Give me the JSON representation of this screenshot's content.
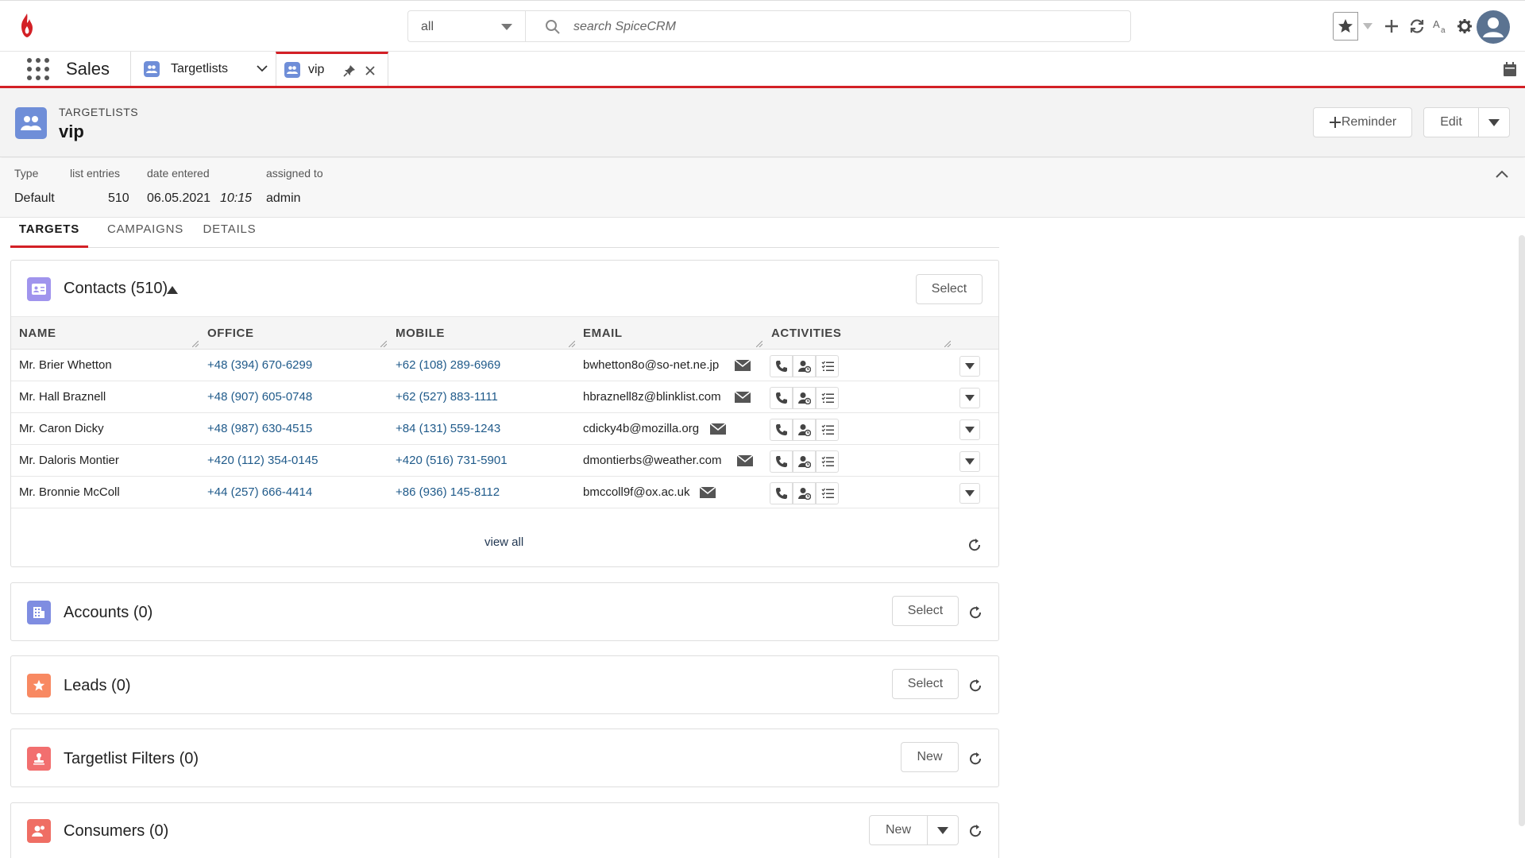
{
  "header": {
    "scope_value": "all",
    "search_placeholder": "search SpiceCRM"
  },
  "nav": {
    "app_name": "Sales",
    "tabs": [
      {
        "label": "Targetlists"
      },
      {
        "label": "vip"
      }
    ]
  },
  "record": {
    "module": "TARGETLISTS",
    "title": "vip",
    "reminder_label": "Reminder",
    "edit_label": "Edit"
  },
  "fields": {
    "labels": {
      "type": "Type",
      "entries": "list entries",
      "date": "date entered",
      "assigned": "assigned to"
    },
    "values": {
      "type": "Default",
      "entries": "510",
      "date": "06.05.2021",
      "time": "10:15",
      "assigned": "admin"
    }
  },
  "tabs": [
    "TARGETS",
    "CAMPAIGNS",
    "DETAILS"
  ],
  "contacts": {
    "title": "Contacts (510)",
    "select_label": "Select",
    "columns": [
      "NAME",
      "OFFICE",
      "MOBILE",
      "EMAIL",
      "ACTIVITIES"
    ],
    "rows": [
      {
        "name": "Mr. Brier Whetton",
        "office": "+48 (394) 670-6299",
        "mobile": "+62 (108) 289-6969",
        "email": "bwhetton8o@so-net.ne.jp"
      },
      {
        "name": "Mr. Hall Braznell",
        "office": "+48 (907) 605-0748",
        "mobile": "+62 (527) 883-1111",
        "email": "hbraznell8z@blinklist.com"
      },
      {
        "name": "Mr. Caron Dicky",
        "office": "+48 (987) 630-4515",
        "mobile": "+84 (131) 559-1243",
        "email": "cdicky4b@mozilla.org"
      },
      {
        "name": "Mr. Daloris Montier",
        "office": "+420 (112) 354-0145",
        "mobile": "+420 (516) 731-5901",
        "email": "dmontierbs@weather.com"
      },
      {
        "name": "Mr. Bronnie McColl",
        "office": "+44 (257) 666-4414",
        "mobile": "+86 (936) 145-8112",
        "email": "bmccoll9f@ox.ac.uk"
      }
    ],
    "view_all_label": "view all"
  },
  "panels": {
    "accounts": {
      "title": "Accounts (0)",
      "button": "Select"
    },
    "leads": {
      "title": "Leads (0)",
      "button": "Select"
    },
    "filters": {
      "title": "Targetlist Filters (0)",
      "button": "New"
    },
    "consumers": {
      "title": "Consumers (0)",
      "button": "New"
    }
  },
  "colors": {
    "accent_red": "#d32026",
    "targetlist_blue": "#6f8ed8",
    "contacts_purple": "#a094ed",
    "accounts_blue": "#7f8de1",
    "leads_orange": "#f88962",
    "filters_red": "#f26f6f",
    "consumers_red": "#ef6e64"
  }
}
